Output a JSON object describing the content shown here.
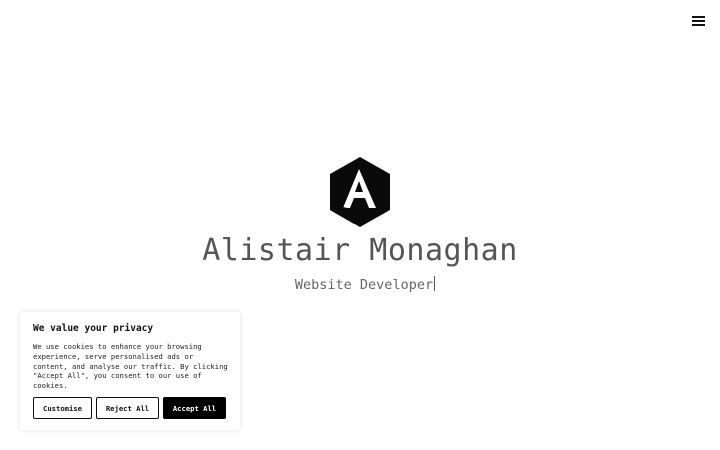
{
  "header": {
    "menu_icon": "hamburger-menu-icon"
  },
  "hero": {
    "logo_icon": "hexagon-a-logo-icon",
    "name": "Alistair Monaghan",
    "role": "Website Developer"
  },
  "cookie_banner": {
    "title": "We value your privacy",
    "text": "We use cookies to enhance your browsing experience, serve personalised ads or content, and analyse our traffic. By clicking \"Accept All\", you consent to our use of cookies.",
    "buttons": {
      "customise": "Customise",
      "reject": "Reject All",
      "accept": "Accept All"
    }
  },
  "colors": {
    "text_dark": "#111111",
    "name_gray": "#555555",
    "role_gray": "#666666",
    "accept_bg": "#000000"
  }
}
